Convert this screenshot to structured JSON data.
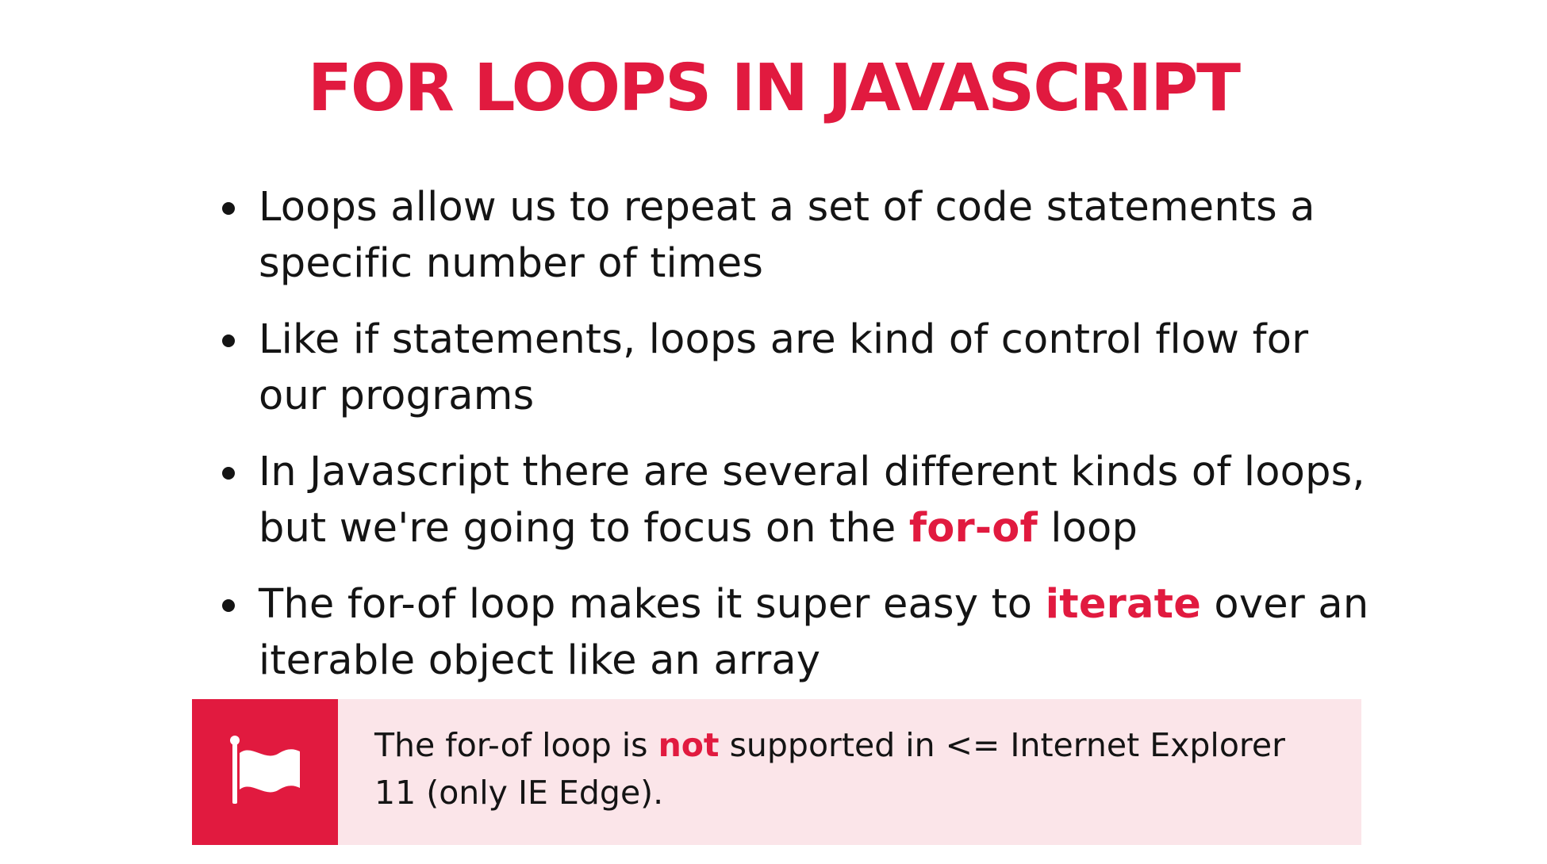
{
  "slide": {
    "title": "FOR LOOPS IN JAVASCRIPT",
    "bullets": [
      {
        "text": "Loops allow us to repeat a set of code statements a specific number of times"
      },
      {
        "text": "Like if statements, loops are kind of control flow for our programs"
      },
      {
        "before": "In Javascript there are several different kinds of loops, but we're going to focus on the ",
        "highlight": "for-of",
        "after": " loop"
      },
      {
        "before": "The for-of loop makes it super easy to ",
        "highlight": "iterate",
        "after": " over an iterable object like an array"
      }
    ],
    "note": {
      "icon": "flag-icon",
      "before": "The for-of loop is ",
      "highlight": "not",
      "after": " supported in <= Internet Explorer 11 (only IE Edge)."
    }
  },
  "colors": {
    "accent": "#e11a3f",
    "note_background": "#fbe5e9",
    "text": "#141414",
    "background": "#ffffff"
  }
}
